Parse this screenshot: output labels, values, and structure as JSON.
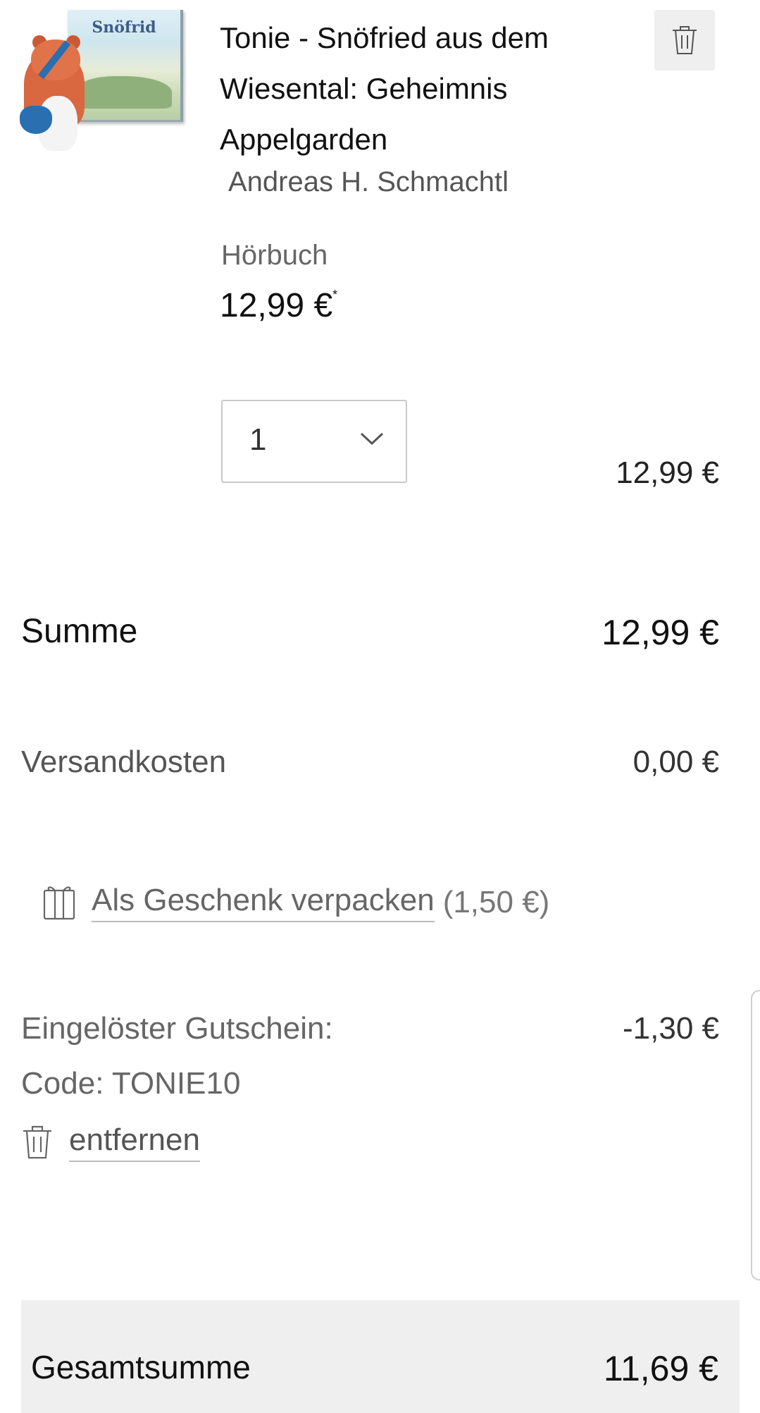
{
  "product": {
    "title": "Tonie - Snöfried aus dem Wiesental: Geheimnis Appelgarden",
    "author": "Andreas H. Schmachtl",
    "format": "Hörbuch",
    "price": "12,99 €",
    "price_asterisk": "*",
    "quantity": "1",
    "line_total": "12,99 €",
    "image_cover_text": "Snöfrid"
  },
  "summary": {
    "sum_label": "Summe",
    "sum_value": "12,99 €",
    "shipping_label": "Versandkosten",
    "shipping_value": "0,00 €"
  },
  "gift": {
    "link_label": "Als Geschenk verpacken",
    "fee": "(1,50 €)"
  },
  "voucher": {
    "label": "Eingelöster Gutschein:",
    "value": "-1,30 €",
    "code": "Code: TONIE10",
    "remove_label": "entfernen"
  },
  "total": {
    "label": "Gesamtsumme",
    "value": "11,69 €"
  },
  "icons": {
    "delete": "trash-icon",
    "dropdown": "chevron-down-icon",
    "gift": "gift-icon"
  }
}
